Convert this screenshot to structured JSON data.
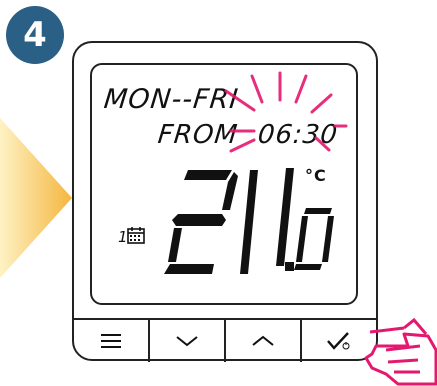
{
  "step": {
    "number": "4"
  },
  "display": {
    "days": "MON--FRI",
    "from_label": "FROM",
    "from_time": "06:30",
    "temperature_int": "21",
    "temperature_dec": ".0",
    "unit": "°C",
    "program_number": "1"
  },
  "buttons": [
    {
      "icon": "menu-icon"
    },
    {
      "icon": "chevron-down-icon"
    },
    {
      "icon": "chevron-up-icon"
    },
    {
      "icon": "check-power-icon"
    }
  ],
  "colors": {
    "badge": "#2a5f86",
    "blink": "#e5186f",
    "arrow_light": "#fde7a3",
    "arrow_dark": "#f4b63f",
    "hand": "#e5186f"
  }
}
